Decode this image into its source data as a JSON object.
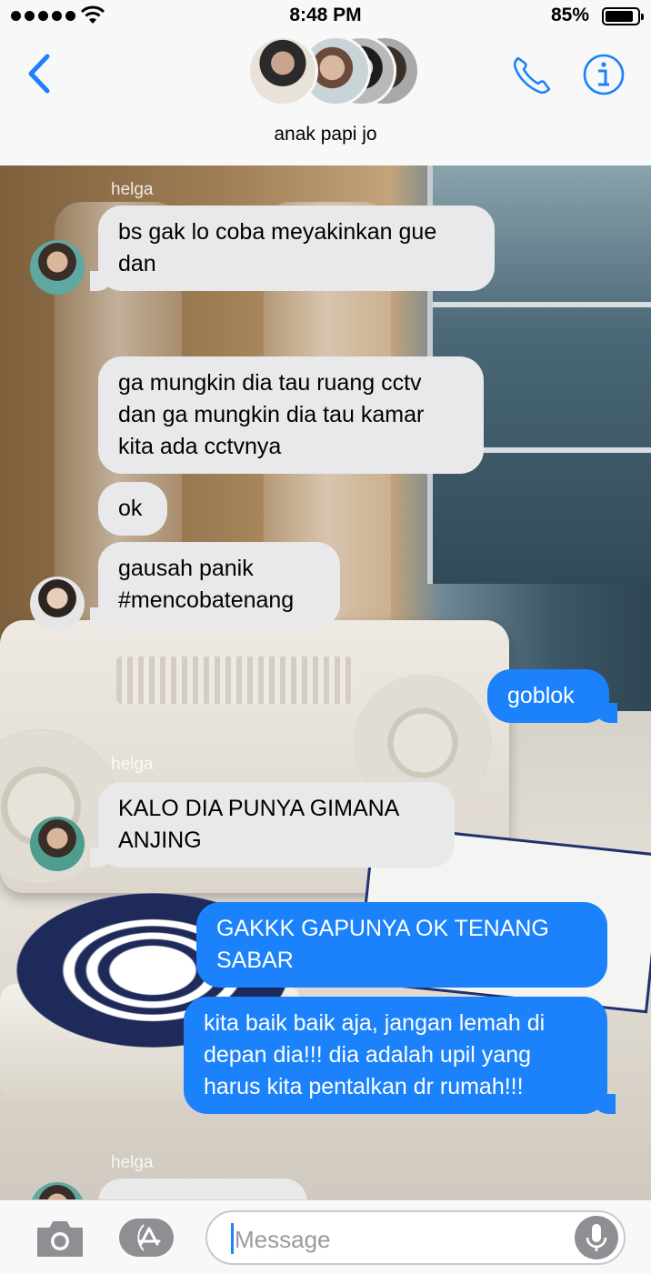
{
  "status_bar": {
    "time": "8:48 PM",
    "battery_percent": "85%",
    "battery_level": 0.85,
    "signal_bars": 5
  },
  "header": {
    "group_name": "anak papi jo",
    "participant_count": 4
  },
  "messages": [
    {
      "sender": "helga",
      "text": "bs gak lo coba meyakinkan gue\ndan",
      "direction": "incoming"
    },
    {
      "sender": "",
      "text": "ga mungkin dia tau ruang cctv\ndan ga mungkin dia tau kamar\nkita ada cctvnya",
      "direction": "incoming"
    },
    {
      "sender": "",
      "text": "ok",
      "direction": "incoming"
    },
    {
      "sender": "",
      "text": "gausah panik\n#mencobatenang",
      "direction": "incoming"
    },
    {
      "sender": "",
      "text": "goblok",
      "direction": "outgoing"
    },
    {
      "sender": "helga",
      "text": "KALO DIA PUNYA GIMANA\nANJING",
      "direction": "incoming"
    },
    {
      "sender": "",
      "text": "GAKKK GAPUNYA OK TENANG\nSABAR",
      "direction": "outgoing"
    },
    {
      "sender": "",
      "text": "kita baik baik aja, jangan lemah di\ndepan dia!!! dia adalah upil yang\nharus kita pentalkan dr rumah!!!",
      "direction": "outgoing"
    },
    {
      "sender": "helga",
      "text": "",
      "direction": "incoming"
    }
  ],
  "input": {
    "placeholder": "Message"
  },
  "colors": {
    "outgoing_bubble": "#1b82fb",
    "incoming_bubble": "#e9e9eb",
    "accent": "#1b82fb"
  }
}
